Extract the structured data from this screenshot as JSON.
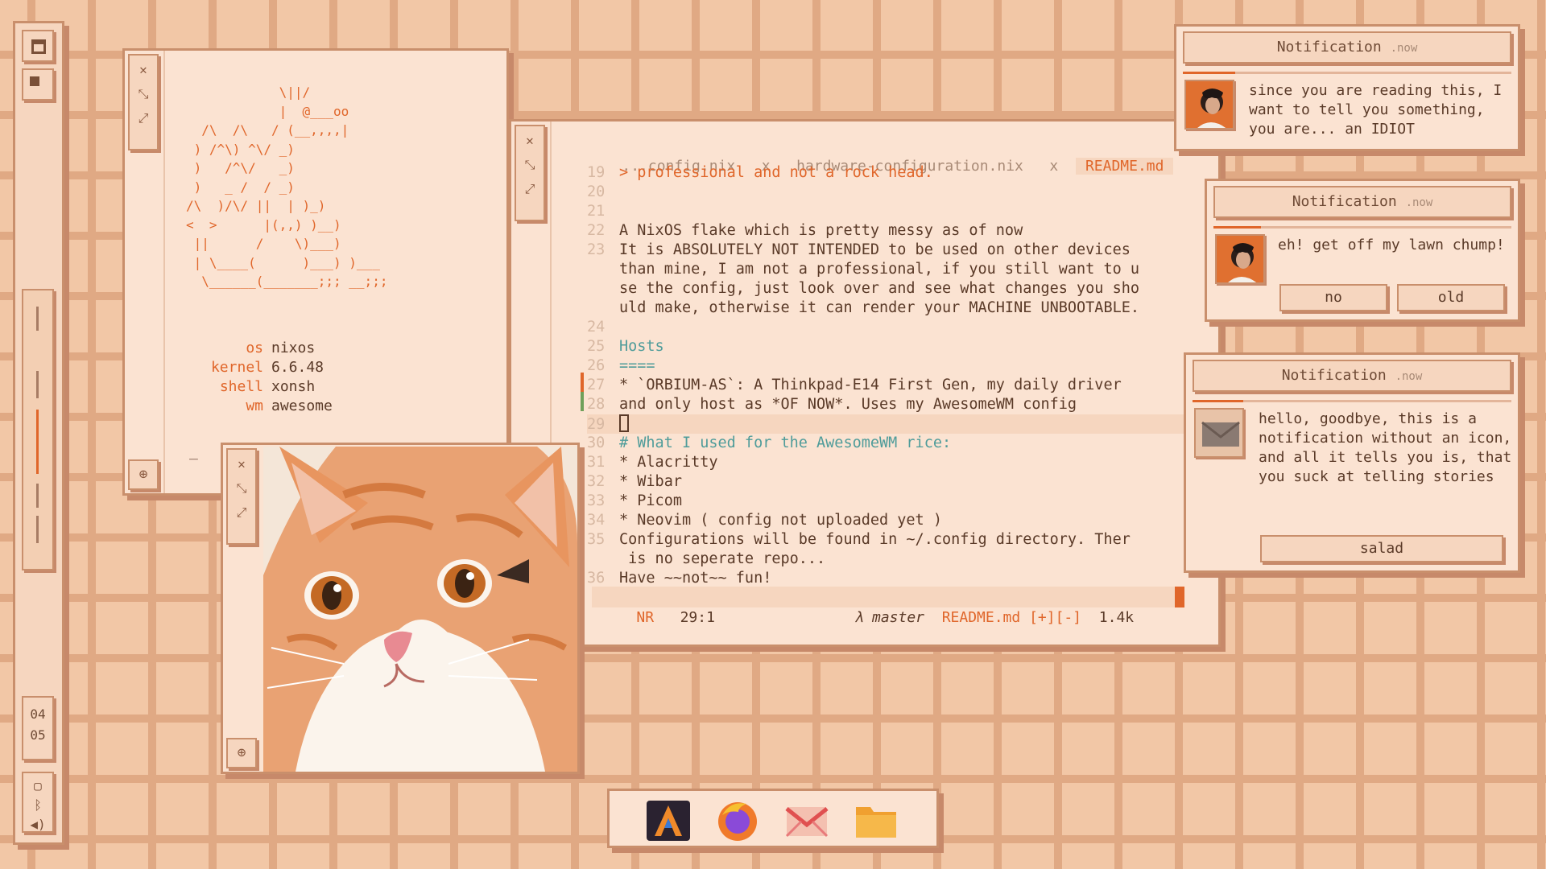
{
  "leftbar": {
    "clock_hour": "04",
    "clock_minute": "05"
  },
  "fetch": {
    "ascii_art": "            \\||/\n            |  @___oo\n  /\\  /\\   / (__,,,,|\n ) /^\\) ^\\/ _)\n )   /^\\/   _)\n )   _ /  / _)\n/\\  )/\\/ ||  | )_)\n<  >      |(,,) )__)\n ||      /    \\)___)\n | \\____(      )___) )___\n  \\______(_______;;; __;;;",
    "os_key": "os",
    "os_val": "nixos",
    "kernel_key": "kernel",
    "kernel_val": "6.6.48",
    "shell_key": "shell",
    "shell_val": "xonsh",
    "wm_key": "wm",
    "wm_val": "awesome",
    "prompt": "_"
  },
  "editor": {
    "tab1": "...config.nix",
    "tab1_close": "x",
    "tab2": "hardware-configuration.nix",
    "tab2_close": "x",
    "tab3": "README.md",
    "lines": [
      {
        "n": "19",
        "t": "> professional and not a rock head."
      },
      {
        "n": "20",
        "t": ""
      },
      {
        "n": "21",
        "t": ""
      },
      {
        "n": "22",
        "t": "A NixOS flake which is pretty messy as of now"
      },
      {
        "n": "23",
        "t": "It is ABSOLUTELY NOT INTENDED to be used on other devices"
      },
      {
        "n": "",
        "t": "than mine, I am not a professional, if you still want to u"
      },
      {
        "n": "",
        "t": "se the config, just look over and see what changes you sho"
      },
      {
        "n": "",
        "t": "uld make, otherwise it can render your MACHINE UNBOOTABLE."
      },
      {
        "n": "24",
        "t": ""
      },
      {
        "n": "25",
        "t": "Hosts"
      },
      {
        "n": "26",
        "t": "===="
      },
      {
        "n": "27",
        "t": "* `ORBIUM-AS`: A Thinkpad-E14 First Gen, my daily driver"
      },
      {
        "n": "28",
        "t": "and only host as *OF NOW*. Uses my AwesomeWM config"
      },
      {
        "n": "29",
        "t": ""
      },
      {
        "n": "30",
        "t": "# What I used for the AwesomeWM rice:"
      },
      {
        "n": "31",
        "t": "* Alacritty"
      },
      {
        "n": "32",
        "t": "* Wibar"
      },
      {
        "n": "33",
        "t": "* Picom"
      },
      {
        "n": "34",
        "t": "* Neovim ( config not uploaded yet )"
      },
      {
        "n": "35",
        "t": "Configurations will be found in ~/.config directory. Ther"
      },
      {
        "n": "",
        "t": " is no seperate repo..."
      },
      {
        "n": "36",
        "t": "Have ~~not~~ fun!"
      }
    ],
    "status_mode": "NR",
    "status_pos": "29:1",
    "status_branch": "λ master",
    "status_file": "README.md [+][-]",
    "status_size": "1.4k",
    "colors": {
      "accent": "#e0662a",
      "teal": "#4f9c9a"
    }
  },
  "notifications": [
    {
      "title": "Notification",
      "time": ".now",
      "body": "since you are reading this, I want to tell you something, you are... an IDIOT",
      "progress": 0.16
    },
    {
      "title": "Notification",
      "time": ".now",
      "body": "eh! get off my lawn chump!",
      "btn1": "no",
      "btn2": "old",
      "progress": 0.16
    },
    {
      "title": "Notification",
      "time": ".now",
      "body": "hello, goodbye, this is a notification without an icon, and all it tells you is, that you suck at telling stories",
      "btn": "salad",
      "progress": 0.16
    }
  ],
  "dock": {
    "apps": [
      "alacritty-icon",
      "firefox-icon",
      "mail-icon",
      "folder-icon"
    ]
  }
}
